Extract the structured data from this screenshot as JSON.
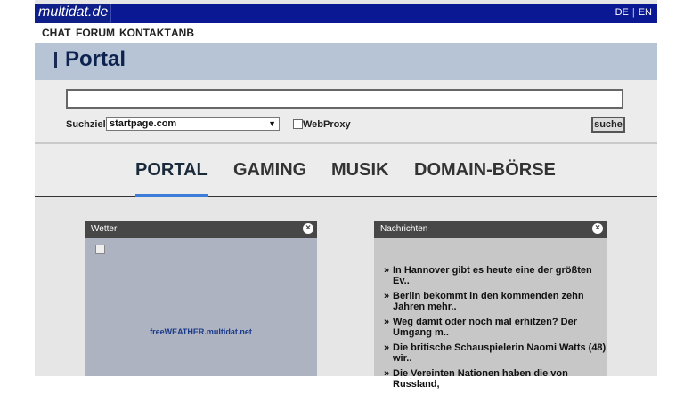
{
  "header": {
    "logo": "multidat.de",
    "lang": [
      "DE",
      "EN"
    ]
  },
  "menu": [
    "CHAT",
    "FORUM",
    "KONTAKT",
    "ANB"
  ],
  "portal": {
    "title": "Portal"
  },
  "search": {
    "input_value": "",
    "suchziel_label": "Suchziel:",
    "selected": "startpage.com",
    "webproxy_label": "WebProxy",
    "button": "suche"
  },
  "tabs": [
    "PORTAL",
    "GAMING",
    "MUSIK",
    "DOMAIN-BÖRSE"
  ],
  "widgets": {
    "wetter": {
      "title": "Wetter",
      "link": "freeWEATHER.multidat.net"
    },
    "news": {
      "title": "Nachrichten",
      "items": [
        "In Hannover gibt es heute eine der größten Ev..",
        "Berlin bekommt in den kommenden zehn Jahren mehr..",
        "Weg damit oder noch mal erhitzen? Der Umgang m..",
        "Die britische Schauspielerin Naomi Watts (48) wir..",
        "Die Vereinten Nationen haben die von Russland,"
      ]
    }
  },
  "colors": {
    "topbar": "#0b1894",
    "portal_band": "#b7c4d6",
    "tab_active": "#3b7dd8"
  }
}
